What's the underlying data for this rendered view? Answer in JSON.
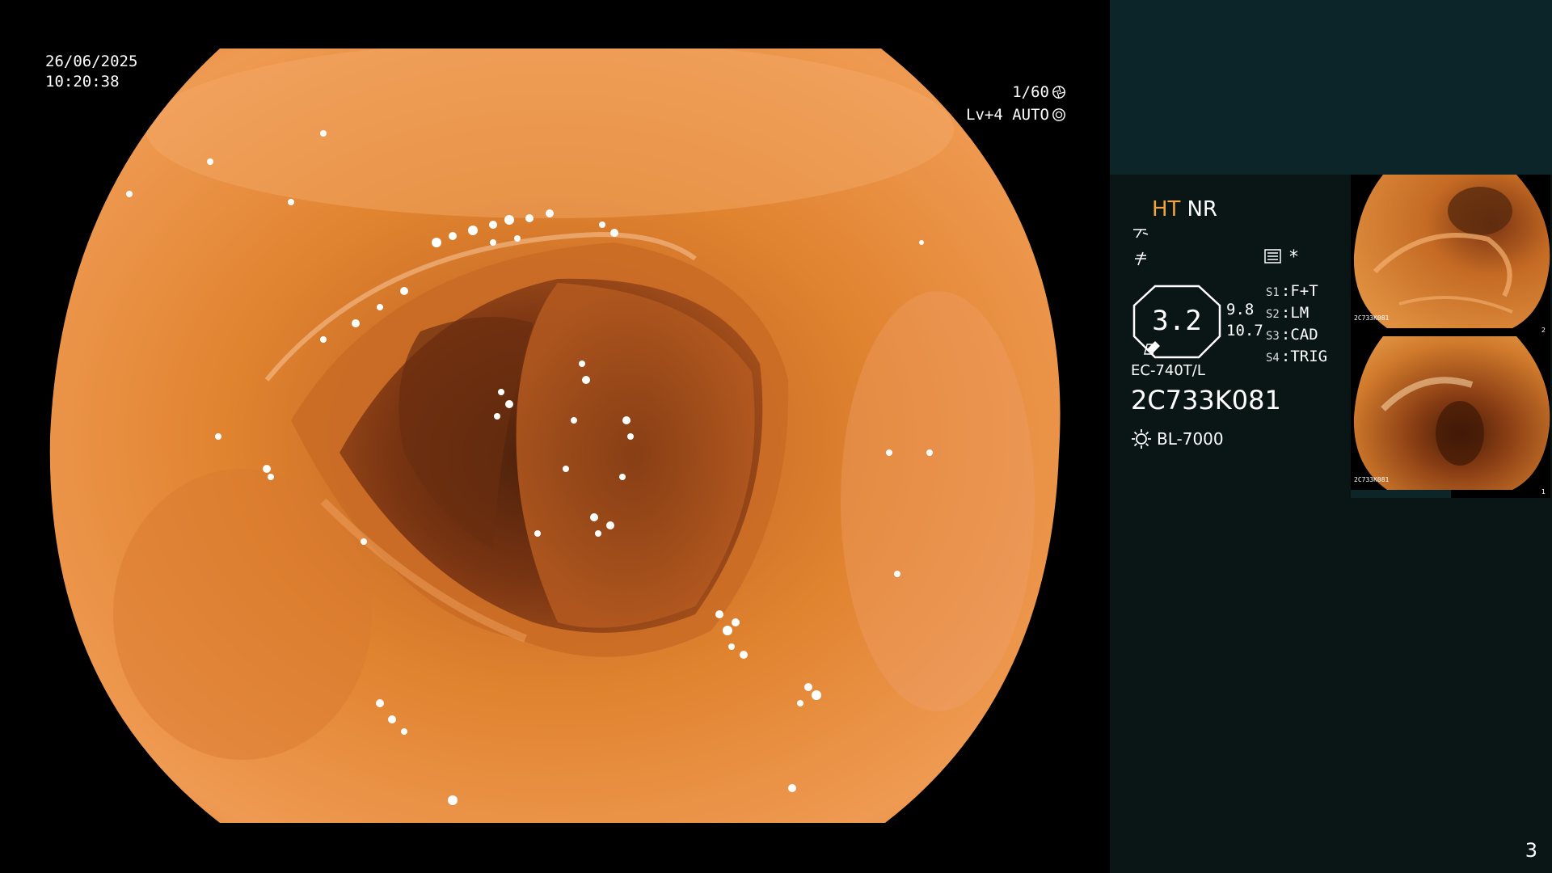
{
  "overlay": {
    "date": "26/06/2025",
    "time": "10:20:38",
    "shutter": "1/60",
    "level": "Lv+4 AUTO"
  },
  "panel": {
    "mode_ht": "HT",
    "mode_nr": "NR",
    "zoom": "3.2",
    "zoom_side_1": "9.8",
    "zoom_side_2": "10.7",
    "scope_model": "EC-740T/L",
    "scope_serial": "2C733K081",
    "light_source": "BL-7000",
    "switches": [
      {
        "key": "S1",
        "label": "F+T"
      },
      {
        "key": "S2",
        "label": "LM"
      },
      {
        "key": "S3",
        "label": "CAD"
      },
      {
        "key": "S4",
        "label": "TRIG"
      }
    ],
    "star": "*",
    "thumbnails": [
      {
        "serial": "2C733K081",
        "number": "2"
      },
      {
        "serial": "2C733K081",
        "number": "1"
      }
    ]
  },
  "page_number": "3",
  "colors": {
    "mucosa": "#e58a3a",
    "lumen": "#5a2a10",
    "panel_bg": "#0a1616",
    "panel_top": "#0c2529",
    "accent_ht": "#f0a43b"
  },
  "icons": [
    "aperture-icon",
    "auto-iris-icon",
    "scope-angle-icon",
    "structure-icon",
    "settings-list-icon",
    "light-source-icon"
  ]
}
